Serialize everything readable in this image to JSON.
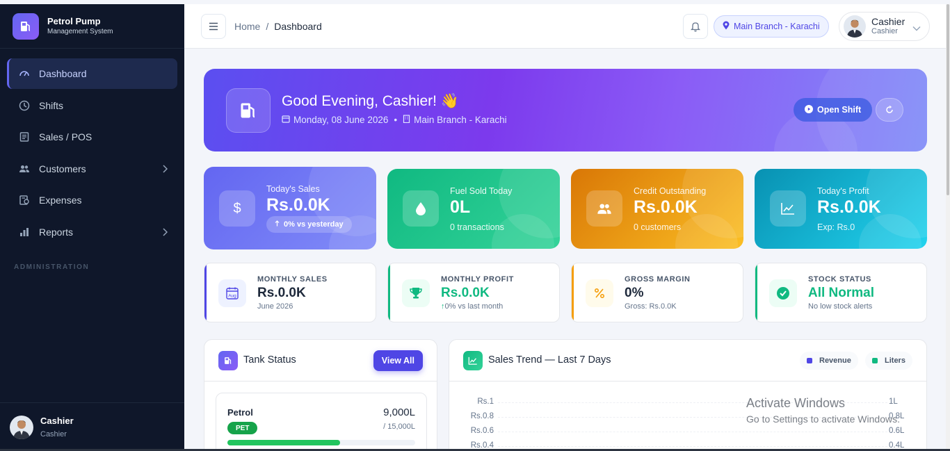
{
  "app": {
    "brand_title": "Petrol Pump",
    "brand_subtitle": "Management System"
  },
  "sidebar": {
    "items": [
      {
        "label": "Dashboard",
        "icon": "dashboard-icon",
        "active": true
      },
      {
        "label": "Shifts",
        "icon": "clock-icon"
      },
      {
        "label": "Sales / POS",
        "icon": "receipt-icon"
      },
      {
        "label": "Customers",
        "icon": "users-icon",
        "has_children": true
      },
      {
        "label": "Expenses",
        "icon": "wallet-icon"
      },
      {
        "label": "Reports",
        "icon": "bar-chart-icon",
        "has_children": true
      }
    ],
    "section_label": "ADMINISTRATION",
    "user": {
      "name": "Cashier",
      "role": "Cashier"
    }
  },
  "header": {
    "breadcrumb_home": "Home",
    "breadcrumb_separator": "/",
    "breadcrumb_current": "Dashboard",
    "branch": "Main Branch - Karachi",
    "user_name": "Cashier",
    "user_role": "Cashier"
  },
  "hero": {
    "greeting": "Good Evening, Cashier! 👋",
    "date": "Monday, 08 June 2026",
    "branch": "Main Branch - Karachi",
    "open_shift_label": "Open Shift"
  },
  "stats": [
    {
      "label": "Today's Sales",
      "value": "Rs.0.0K",
      "badge": "0% vs yesterday",
      "icon": "dollar-icon",
      "color": "#6366f1"
    },
    {
      "label": "Fuel Sold Today",
      "value": "0L",
      "sub": "0 transactions",
      "icon": "droplet-icon",
      "color": "#10b981"
    },
    {
      "label": "Credit Outstanding",
      "value": "Rs.0.0K",
      "sub": "0 customers",
      "icon": "users-icon",
      "color": "#f59e0b"
    },
    {
      "label": "Today's Profit",
      "value": "Rs.0.0K",
      "sub": "Exp: Rs.0",
      "icon": "trend-icon",
      "color": "#06b6d4"
    }
  ],
  "mini_cards": [
    {
      "label": "MONTHLY SALES",
      "value": "Rs.0.0K",
      "sub": "June 2026",
      "icon": "calendar-icon",
      "icon_text": "Aug",
      "color": "#4f46e5"
    },
    {
      "label": "MONTHLY PROFIT",
      "value": "Rs.0.0K",
      "sub": "0% vs last month",
      "icon": "trophy-icon",
      "color": "#10b981"
    },
    {
      "label": "GROSS MARGIN",
      "value": "0%",
      "sub": "Gross: Rs.0.0K",
      "icon": "percent-icon",
      "color": "#f59e0b"
    },
    {
      "label": "STOCK STATUS",
      "value": "All Normal",
      "sub": "No low stock alerts",
      "icon": "check-circle-icon",
      "color": "#10b981"
    }
  ],
  "tank_panel": {
    "title": "Tank Status",
    "view_all": "View All",
    "tanks": [
      {
        "name": "Petrol",
        "badge": "PET",
        "level": "9,000L",
        "capacity": "/ 15,000L",
        "fill": 0.6
      }
    ]
  },
  "trend_panel": {
    "title": "Sales Trend — Last 7 Days",
    "legend": [
      {
        "label": "Revenue",
        "color": "#4f46e5"
      },
      {
        "label": "Liters",
        "color": "#10b981"
      }
    ],
    "left_ticks": [
      "Rs.1",
      "Rs.0.8",
      "Rs.0.6",
      "Rs.0.4"
    ],
    "right_ticks": [
      "1L",
      "0.8L",
      "0.6L",
      "0.4L"
    ]
  },
  "chart_data": {
    "type": "line",
    "title": "Sales Trend — Last 7 Days",
    "series": [
      {
        "name": "Revenue",
        "values": []
      },
      {
        "name": "Liters",
        "values": []
      }
    ],
    "ylim": [
      0,
      1
    ],
    "y_ticks_left": [
      "Rs.1",
      "Rs.0.8",
      "Rs.0.6",
      "Rs.0.4"
    ],
    "y_ticks_right": [
      "1L",
      "0.8L",
      "0.6L",
      "0.4L"
    ],
    "legend_position": "top-right"
  },
  "overlay": {
    "line1": "Activate Windows",
    "line2": "Go to Settings to activate Windows."
  }
}
